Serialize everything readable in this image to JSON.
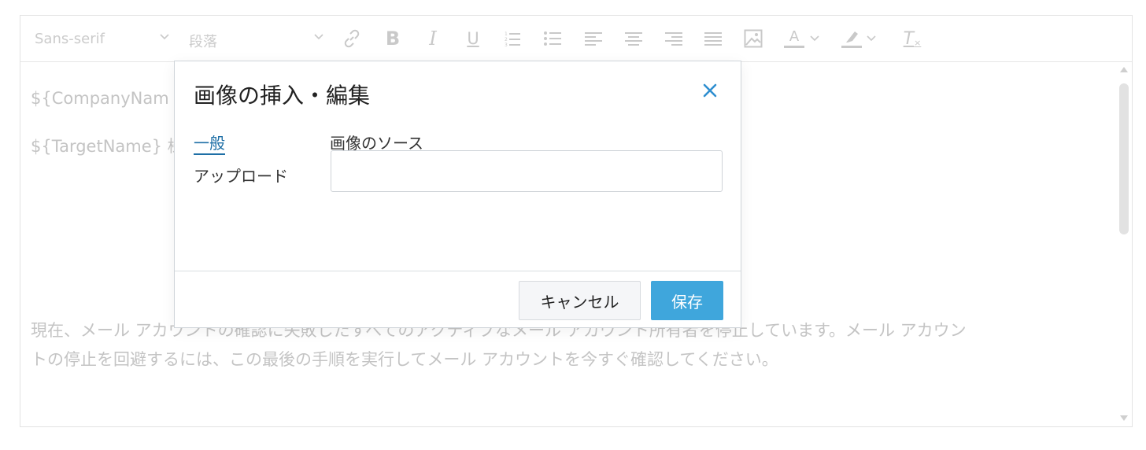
{
  "toolbar": {
    "font_select": "Sans-serif",
    "paragraph_select": "段落",
    "icons": [
      "link-icon",
      "bold-icon",
      "italic-icon",
      "underline-icon",
      "ordered-list-icon",
      "bullet-list-icon",
      "align-left-icon",
      "align-center-icon",
      "align-right-icon",
      "align-justify-icon",
      "image-icon",
      "text-color-icon",
      "highlight-color-icon",
      "clear-format-icon"
    ],
    "bold_glyph": "B",
    "italic_glyph": "I",
    "underline_glyph": "U",
    "text_color_glyph": "A",
    "clear_format_glyph": "T"
  },
  "content": {
    "line1": "${CompanyNam",
    "line2": "${TargetName} 様",
    "para_line1": "現在、メール アカウントの確認に失敗したすべてのアクティブなメール アカウント所有者を停止しています。メール アカウン",
    "para_line2": "トの停止を回避するには、この最後の手順を実行してメール アカウントを今すぐ確認してください。"
  },
  "dialog": {
    "title": "画像の挿入・編集",
    "close_icon": "close-icon",
    "tabs": [
      {
        "label": "一般",
        "active": true
      },
      {
        "label": "アップロード",
        "active": false
      }
    ],
    "source_label": "画像のソース",
    "source_value": "",
    "cancel_label": "キャンセル",
    "save_label": "保存"
  },
  "colors": {
    "accent": "#3fa6dc",
    "tab_active": "#1e6fa6",
    "muted_text": "#c4c4c4"
  }
}
